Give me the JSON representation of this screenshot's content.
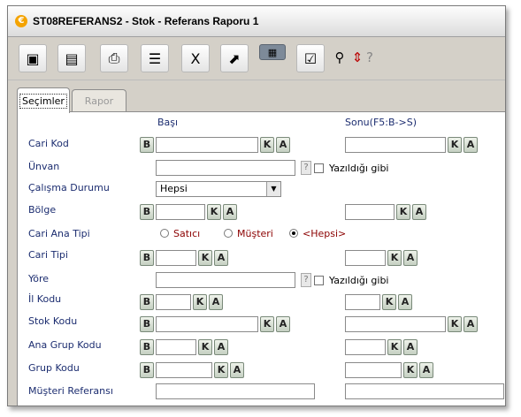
{
  "window": {
    "title": "ST08REFERANS2 - Stok - Referans Raporu 1",
    "app_icon": "app-logo-icon"
  },
  "toolbar": {
    "buttons": [
      {
        "icon": "box-icon"
      },
      {
        "icon": "documents-icon"
      },
      {
        "icon": "printer-icon"
      },
      {
        "icon": "text-list-icon"
      },
      {
        "icon": "excel-icon"
      },
      {
        "icon": "export-icon"
      },
      {
        "icon": "grid-icon"
      },
      {
        "icon": "checklist-icon"
      },
      {
        "icon": "broom-icon"
      },
      {
        "icon": "sort-icon"
      }
    ],
    "help_glyph": "?"
  },
  "tabs": [
    {
      "label": "Seçimler",
      "active": true
    },
    {
      "label": "Rapor",
      "active": false
    }
  ],
  "form": {
    "header_start": "Başı",
    "header_end": "Sonu(F5:B->S)",
    "btn_b": "B",
    "btn_k": "K",
    "btn_a": "A",
    "help_glyph": "?",
    "rows": {
      "cari_kod": "Cari Kod",
      "unvan": "Ünvan",
      "calisma_durumu": "Çalışma Durumu",
      "bolge": "Bölge",
      "cari_ana_tipi": "Cari Ana Tipi",
      "cari_tipi": "Cari Tipi",
      "yore": "Yöre",
      "il_kodu": "İl Kodu",
      "stok_kodu": "Stok Kodu",
      "ana_grup_kodu": "Ana Grup Kodu",
      "grup_kodu": "Grup Kodu",
      "musteri_referansi": "Müşteri Referansı"
    },
    "yazildigi_gibi": "Yazıldığı gibi",
    "calisma_durumu_value": "Hepsi",
    "cari_ana_tipi_options": [
      "Satıcı",
      "Müşteri",
      "<Hepsi>"
    ],
    "cari_ana_tipi_selected": "<Hepsi>"
  }
}
